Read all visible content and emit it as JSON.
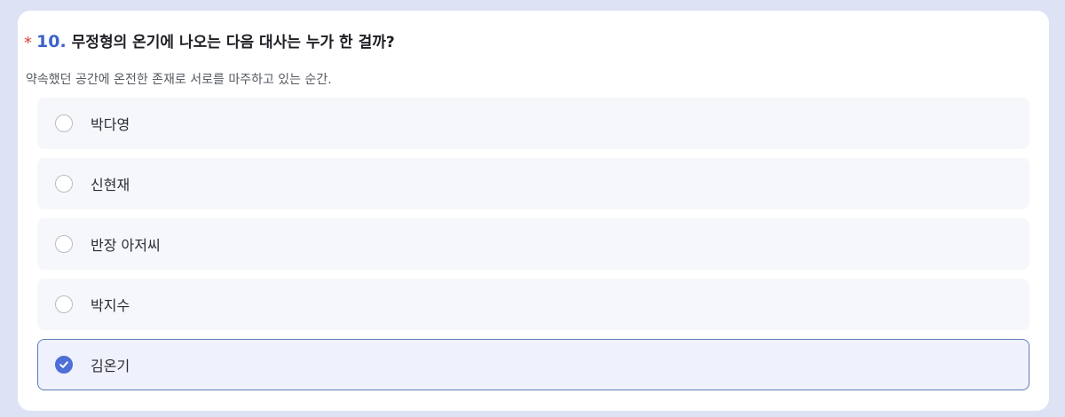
{
  "question": {
    "required_mark": "*",
    "number": "10.",
    "text": "무정형의 온기에 나오는 다음 대사는 누가 한 걸까?",
    "description": "약속했던 공간에 온전한 존재로 서로를 마주하고 있는 순간."
  },
  "options": [
    {
      "label": "박다영",
      "selected": false
    },
    {
      "label": "신현재",
      "selected": false
    },
    {
      "label": "반장 아저씨",
      "selected": false
    },
    {
      "label": "박지수",
      "selected": false
    },
    {
      "label": "김온기",
      "selected": true
    }
  ],
  "colors": {
    "accent": "#4f6fd8",
    "required": "#d8443e",
    "selected_border": "#5f7db4",
    "page_background": "#dde3f5"
  },
  "icons": {
    "unchecked": "radio-unchecked-icon",
    "checked": "radio-checked-icon"
  }
}
